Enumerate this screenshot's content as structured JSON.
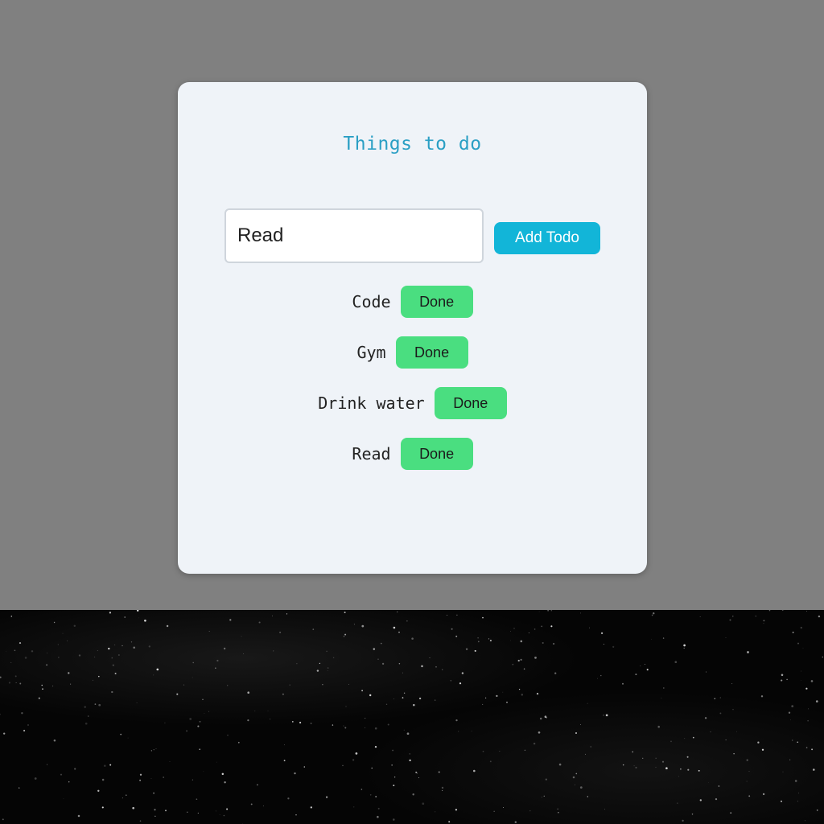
{
  "app": {
    "title": "Things to do"
  },
  "input": {
    "value": "Read",
    "placeholder": ""
  },
  "buttons": {
    "add_label": "Add Todo"
  },
  "todos": [
    {
      "text": "Code",
      "action_label": "Done"
    },
    {
      "text": "Gym",
      "action_label": "Done"
    },
    {
      "text": "Drink water",
      "action_label": "Done"
    },
    {
      "text": "Read",
      "action_label": "Done"
    }
  ],
  "colors": {
    "page_background": "#808080",
    "card_background": "#eff3f8",
    "title": "#2a9fc4",
    "add_button": "#12b5d8",
    "done_button": "#4ade80"
  }
}
